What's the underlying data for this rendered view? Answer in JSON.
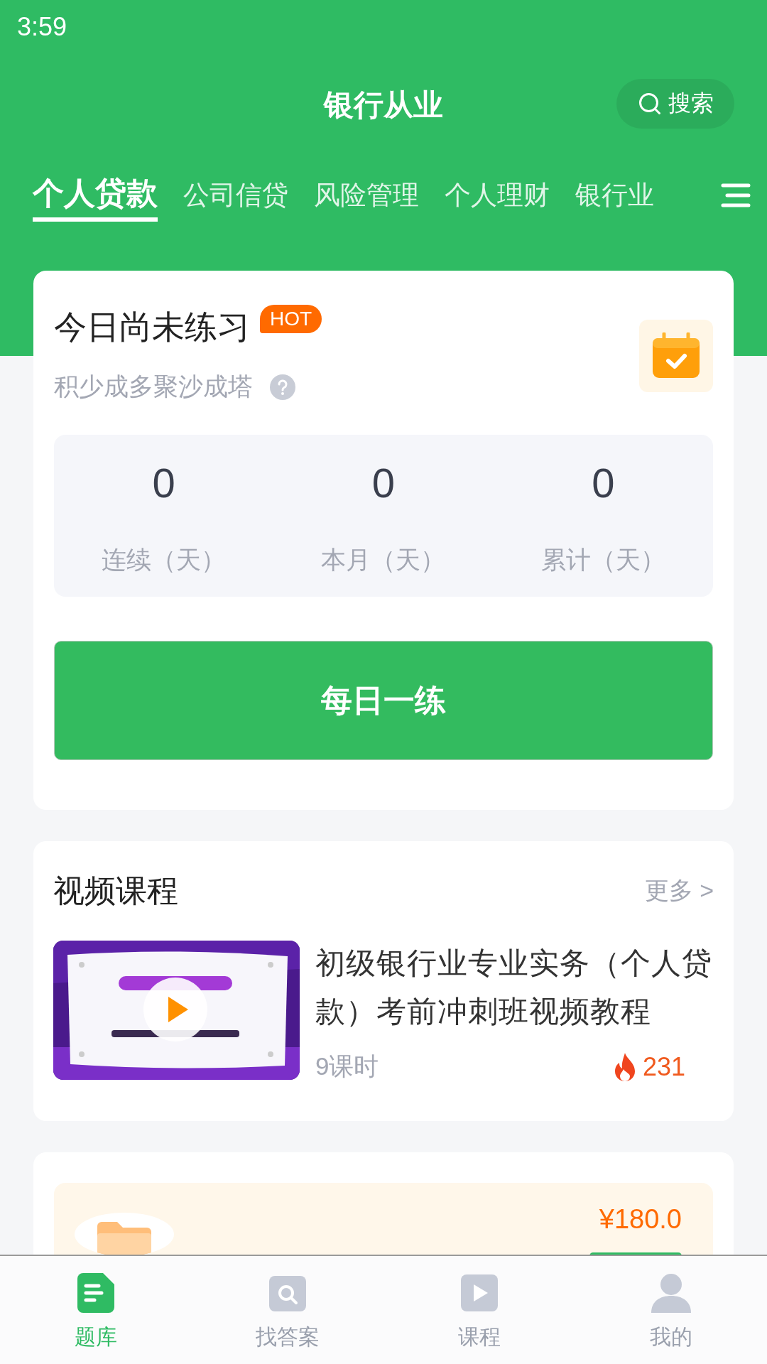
{
  "status_bar": {
    "time": "3:59"
  },
  "header": {
    "title": "银行从业",
    "search": {
      "label": "搜索"
    }
  },
  "tabs": [
    {
      "label": "个人贷款",
      "selected": true
    },
    {
      "label": "公司信贷",
      "selected": false
    },
    {
      "label": "风险管理",
      "selected": false
    },
    {
      "label": "个人理财",
      "selected": false
    },
    {
      "label": "银行业",
      "selected": false
    }
  ],
  "practice": {
    "title": "今日尚未练习",
    "badge": "HOT",
    "subtitle": "积少成多聚沙成塔",
    "stats": [
      {
        "value": "0",
        "label": "连续（天）"
      },
      {
        "value": "0",
        "label": "本月（天）"
      },
      {
        "value": "0",
        "label": "累计（天）"
      }
    ],
    "button": "每日一练"
  },
  "video_courses": {
    "title": "视频课程",
    "more": "更多 >",
    "courses": [
      {
        "title": "初级银行业专业实务（个人贷款）考前冲刺班视频教程",
        "lessons": "9课时",
        "views": "231"
      }
    ]
  },
  "product": {
    "price": "¥180.0"
  },
  "bottom_nav": [
    {
      "label": "题库",
      "selected": true
    },
    {
      "label": "找答案",
      "selected": false
    },
    {
      "label": "课程",
      "selected": false
    },
    {
      "label": "我的",
      "selected": false
    }
  ]
}
